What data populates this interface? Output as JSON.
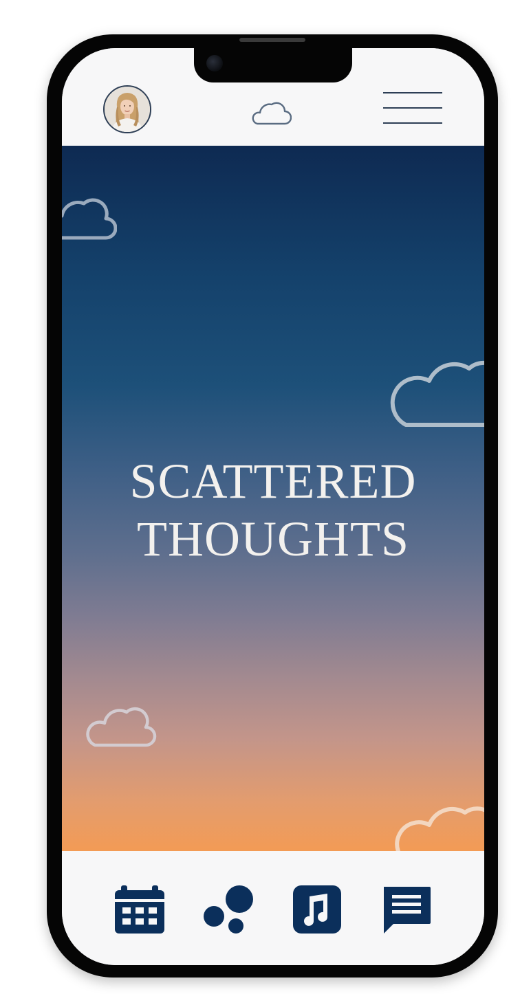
{
  "header": {
    "avatar_alt": "profile photo",
    "center_icon": "cloud-icon",
    "menu_icon": "hamburger-menu-icon"
  },
  "hero": {
    "title_line1": "SCATTERED",
    "title_line2": "THOUGHTS"
  },
  "bottom_nav": {
    "items": [
      {
        "icon": "calendar-icon"
      },
      {
        "icon": "bubbles-icon"
      },
      {
        "icon": "music-note-icon"
      },
      {
        "icon": "chat-message-icon"
      }
    ]
  },
  "colors": {
    "navy": "#0b2f5b",
    "header_bg": "#f7f7f8",
    "gradient_top": "#0e2a52",
    "gradient_bottom": "#f39b55",
    "title_text": "#f3f1ee"
  }
}
